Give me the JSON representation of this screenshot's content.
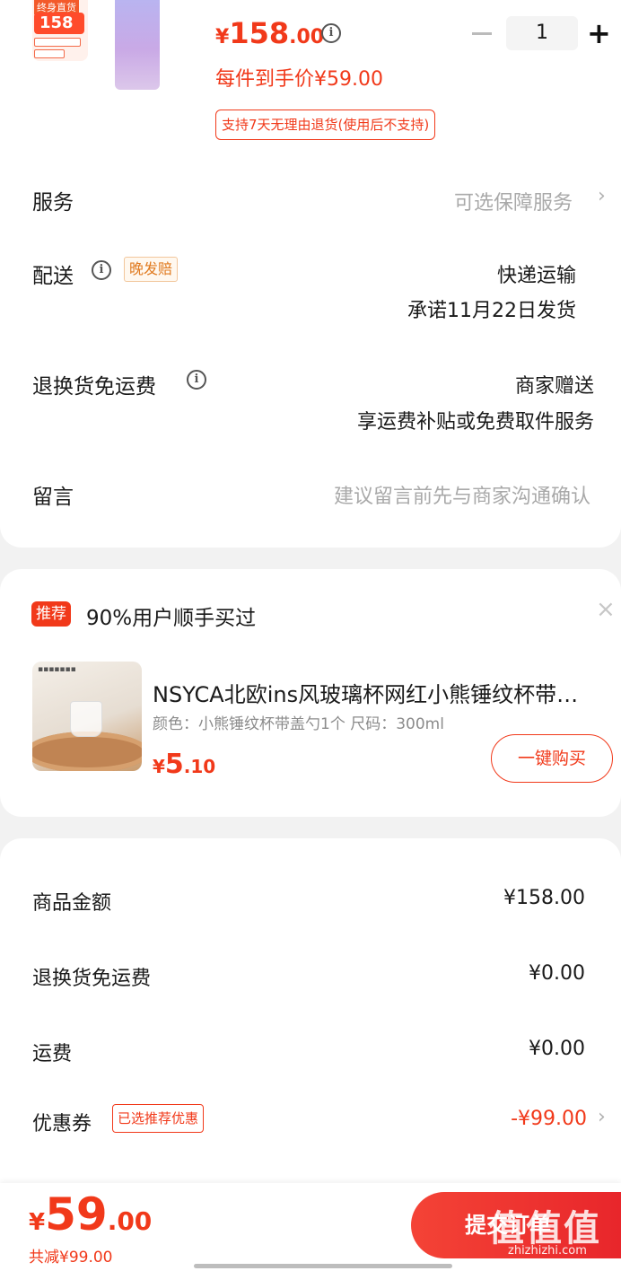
{
  "product": {
    "thumb_tag": "终身直货",
    "thumb_price": "158",
    "price_symbol": "¥",
    "price_int": "158",
    "price_dec": ".00",
    "quantity": "1",
    "hand_price": "每件到手价¥59.00",
    "return_policy": "支持7天无理由退货(使用后不支持)"
  },
  "rows": {
    "service_label": "服务",
    "service_value": "可选保障服务",
    "delivery_label": "配送",
    "delivery_tag": "晚发赔",
    "delivery_value": "快递运输",
    "delivery_promise": "承诺11月22日发货",
    "return_label": "退换货免运费",
    "return_value": "商家赠送",
    "return_sub": "享运费补贴或免费取件服务",
    "message_label": "留言",
    "message_placeholder": "建议留言前先与商家沟通确认"
  },
  "recommend": {
    "badge": "推荐",
    "title": "90%用户顺手买过",
    "item_name": "NSYCA北欧ins风玻璃杯网红小熊锤纹杯带盖勺",
    "item_spec": "颜色：小熊锤纹杯带盖勺1个   尺码：300ml",
    "price_symbol": "¥",
    "price_int": "5",
    "price_dec": ".10",
    "buy_label": "一键购买"
  },
  "amounts": {
    "goods_label": "商品金额",
    "goods_value": "¥158.00",
    "return_fee_label": "退换货免运费",
    "return_fee_value": "¥0.00",
    "shipping_label": "运费",
    "shipping_value": "¥0.00",
    "coupon_label": "优惠券",
    "coupon_tag": "已选推荐优惠",
    "coupon_value": "-¥99.00"
  },
  "bottom": {
    "price_symbol": "¥",
    "total_int": "59",
    "total_dec": ".00",
    "saved": "共减¥99.00",
    "submit_label": "提交订单"
  },
  "watermark": {
    "text": "值值值",
    "domain": "zhizhizhi.com"
  },
  "colors": {
    "accent": "#f1391a",
    "tag_orange": "#e07a1f",
    "muted": "#a9a9a9"
  }
}
